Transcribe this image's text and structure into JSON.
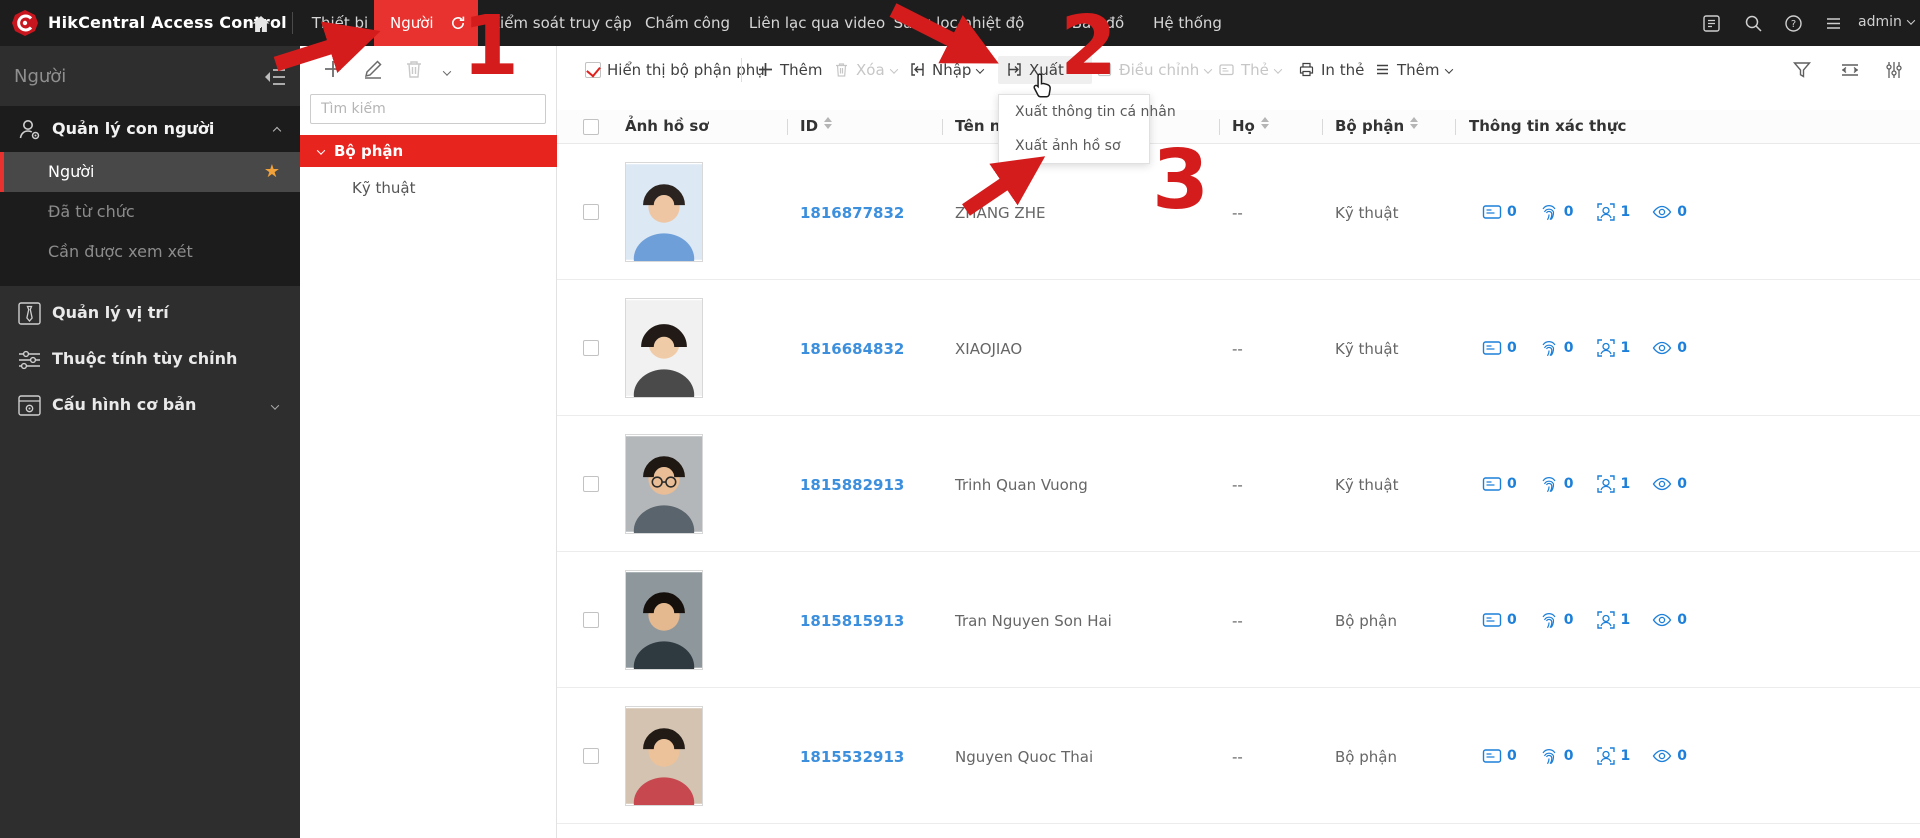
{
  "topbar": {
    "brand": "HikCentral Access Control",
    "tabs": [
      {
        "label": "Thiết bị"
      },
      {
        "label": "Người",
        "active": true
      },
      {
        "label": "Kiểm soát truy cập"
      },
      {
        "label": "Chấm công"
      },
      {
        "label": "Liên lạc qua video"
      },
      {
        "label": "Sàng lọc nhiệt độ"
      },
      {
        "label": "Bản đồ"
      },
      {
        "label": "Hệ thống"
      }
    ],
    "user": "admin"
  },
  "sidebar": {
    "title": "Người",
    "group": {
      "label": "Quản lý con người",
      "items": [
        {
          "label": "Người",
          "active": true
        },
        {
          "label": "Đã từ chức"
        },
        {
          "label": "Cần được xem xét"
        }
      ]
    },
    "items": [
      {
        "label": "Quản lý vị trí"
      },
      {
        "label": "Thuộc tính tùy chỉnh"
      },
      {
        "label": "Cấu hình cơ bản"
      }
    ]
  },
  "tree_panel": {
    "search_placeholder": "Tìm kiếm",
    "root_label": "Bộ phận",
    "child_label": "Kỹ thuật"
  },
  "toolbar": {
    "show_sub": "Hiển thị bộ phận phụ",
    "add": "Thêm",
    "delete": "Xóa",
    "import": "Nhập",
    "export": "Xuất",
    "adjust": "Điều chỉnh",
    "card": "Thẻ",
    "print_card": "In thẻ",
    "more": "Thêm"
  },
  "export_menu": {
    "items": [
      {
        "label": "Xuất thông tin cá nhân"
      },
      {
        "label": "Xuất ảnh hồ sơ"
      }
    ]
  },
  "table": {
    "columns": [
      {
        "label": "Ảnh hồ sơ"
      },
      {
        "label": "ID"
      },
      {
        "label": "Tên người"
      },
      {
        "label": "Họ"
      },
      {
        "label": "Bộ phận"
      },
      {
        "label": "Thông tin xác thực"
      }
    ],
    "rows": [
      {
        "id": "1816877832",
        "first_name": "ZHANG ZHE",
        "last_name": "--",
        "department": "Kỹ thuật",
        "credentials": {
          "card": "0",
          "fingerprint": "0",
          "face": "1",
          "iris": "0"
        },
        "photo": {
          "bg": "#dce8f4",
          "shirt": "#6f9fd8",
          "skin": "#eec6a3",
          "hair": "#2b2320"
        }
      },
      {
        "id": "1816684832",
        "first_name": "XIAOJIAO",
        "last_name": "--",
        "department": "Kỹ thuật",
        "credentials": {
          "card": "0",
          "fingerprint": "0",
          "face": "1",
          "iris": "0"
        },
        "photo": {
          "bg": "#f1f1f1",
          "shirt": "#4a4a4a",
          "skin": "#f0cba8",
          "hair": "#221a16"
        }
      },
      {
        "id": "1815882913",
        "first_name": "Trinh Quan Vuong",
        "last_name": "--",
        "department": "Kỹ thuật",
        "credentials": {
          "card": "0",
          "fingerprint": "0",
          "face": "1",
          "iris": "0"
        },
        "photo": {
          "bg": "#b4b7ba",
          "shirt": "#5a646c",
          "skin": "#e9bd95",
          "hair": "#1e1712"
        }
      },
      {
        "id": "1815815913",
        "first_name": "Tran Nguyen Son Hai",
        "last_name": "--",
        "department": "Bộ phận",
        "credentials": {
          "card": "0",
          "fingerprint": "0",
          "face": "1",
          "iris": "0"
        },
        "photo": {
          "bg": "#8e979c",
          "shirt": "#2f3a40",
          "skin": "#e5b98f",
          "hair": "#15100c"
        }
      },
      {
        "id": "1815532913",
        "first_name": "Nguyen Quoc Thai",
        "last_name": "--",
        "department": "Bộ phận",
        "credentials": {
          "card": "0",
          "fingerprint": "0",
          "face": "1",
          "iris": "0"
        },
        "photo": {
          "bg": "#d3c3b0",
          "shirt": "#c8484f",
          "skin": "#ecc29b",
          "hair": "#221a14"
        }
      }
    ]
  },
  "annotations": {
    "step1": "1",
    "step2": "2",
    "step3": "3"
  },
  "colors": {
    "brand_red": "#e8322f",
    "tree_selected_red": "#e8241f",
    "annotation_red": "#d41c1c",
    "link_blue": "#3c8fdd",
    "credential_blue": "#1c7fd9",
    "star_orange": "#f2a23a"
  }
}
